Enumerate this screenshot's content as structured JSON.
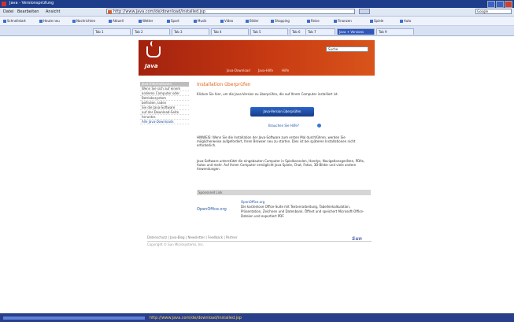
{
  "window": {
    "title": "Java - Versionsprüfung"
  },
  "menubar": {
    "items": [
      "Datei",
      "Bearbeiten",
      "Ansicht"
    ]
  },
  "address": {
    "url": "http://www.java.com/de/download/installed.jsp",
    "search_placeholder": "Google"
  },
  "bookmarks": [
    "Schnellstart",
    "Heute neu",
    "Nachrichten",
    "Aktuell",
    "Wetter",
    "Sport",
    "Musik",
    "Video",
    "Bilder",
    "Shopping",
    "Reise",
    "Finanzen",
    "Spiele",
    "Auto"
  ],
  "tabs": [
    {
      "label": "Tab 1",
      "active": false
    },
    {
      "label": "Tab 2",
      "active": false
    },
    {
      "label": "Tab 3",
      "active": false
    },
    {
      "label": "Tab 4",
      "active": false
    },
    {
      "label": "Tab 5",
      "active": false
    },
    {
      "label": "Tab 6",
      "active": false
    },
    {
      "label": "Tab 7",
      "active": false
    },
    {
      "label": "Java + Versions",
      "active": true
    },
    {
      "label": "Tab 9",
      "active": false
    }
  ],
  "banner": {
    "logo_text": "Java",
    "search_placeholder": "Suche",
    "nav": [
      "Java-Download",
      "Java-Hilfe",
      "Hilfe"
    ]
  },
  "sidebar": {
    "heading": "Java-Informationen",
    "items": [
      {
        "label": "Wenn Sie sich auf einem",
        "hl": false
      },
      {
        "label": "anderen Computer oder",
        "hl": false
      },
      {
        "label": "Betriebssystem",
        "hl": false
      },
      {
        "label": "befinden, laden",
        "hl": false
      },
      {
        "label": "Sie die Java-Software",
        "hl": false
      },
      {
        "label": "auf der Download-Seite",
        "hl": false
      },
      {
        "label": "herunter.",
        "hl": false
      },
      {
        "label": "Alle Java-Downloads",
        "hl": true
      }
    ]
  },
  "content": {
    "title": "Installation überprüfen",
    "intro": "Klicken Sie hier, um die Java-Version zu überprüfen, die auf Ihrem Computer installiert ist.",
    "verify_button": "Java-Version überprüfen",
    "help_link": "Brauchen Sie Hilfe?",
    "hinweis": "HINWEIS: Wenn Sie die Installation der Java-Software zum ersten Mal durchführen, werden Sie möglicherweise aufgefordert, Ihren Browser neu zu starten. Dies ist bei späteren Installationen nicht erforderlich.",
    "para2": "Java-Software unterstützt die eingebauten Computer in Spielkonsolen, Handys, Navigationsgeräten, PDAs, Autos und mehr. Auf Ihrem Computer ermöglicht Java Spiele, Chat, Fotos, 3D-Bilder und viele andere Anwendungen."
  },
  "section": {
    "heading": "Sponsored Link",
    "oo_logo": "OpenOffice.org",
    "oo_title": "OpenOffice.org",
    "oo_desc": "Die kostenlose Office-Suite mit Textverarbeitung, Tabellenkalkulation, Präsentation, Zeichnen und Datenbank. Öffnet und speichert Microsoft-Office-Dateien und exportiert PDF."
  },
  "footer": {
    "line1": "Datenschutz | Java-Blog | Newsletter | Feedback | Partner",
    "line2": "Copyright © Sun Microsystems, Inc.",
    "brand": "Sun"
  },
  "status": {
    "text": "http://www.java.com/de/download/installed.jsp",
    "progress": 1.0
  }
}
